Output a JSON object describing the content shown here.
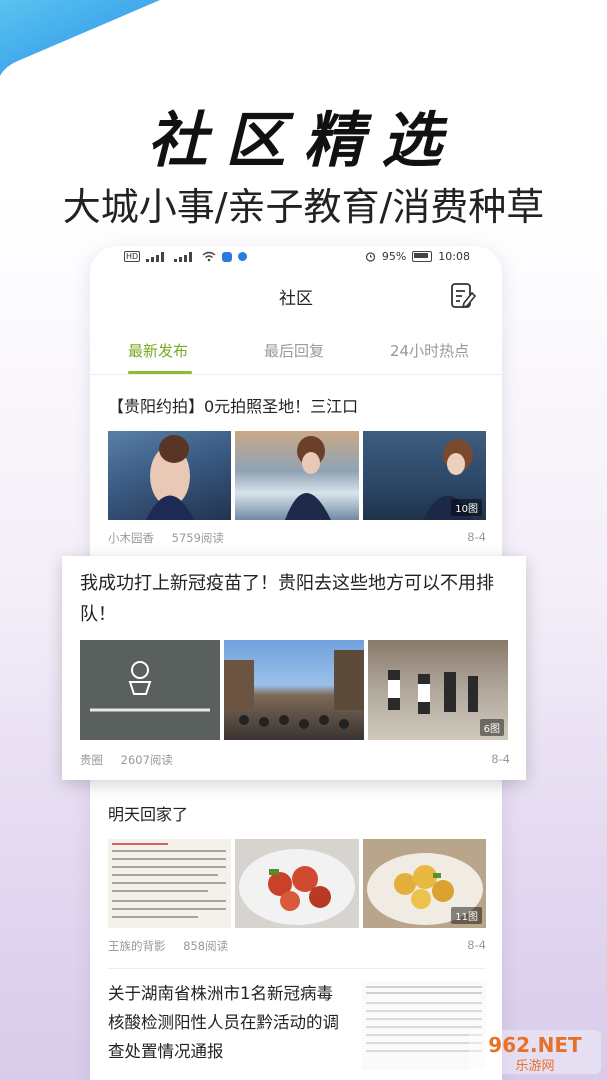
{
  "hero": {
    "title": "社区精选",
    "subtitle": "大城小事/亲子教育/消费种草"
  },
  "statusbar": {
    "battery": "95%",
    "time": "10:08",
    "icons": [
      "hd-icon",
      "signal-icon",
      "signal-icon",
      "wifi-icon",
      "shield-app-icon",
      "app-icon",
      "alarm-icon",
      "battery-icon"
    ]
  },
  "app": {
    "title": "社区",
    "tabs": [
      "最新发布",
      "最后回复",
      "24小时热点"
    ],
    "active_tab": 0,
    "accent": "#8bbd2e"
  },
  "posts": [
    {
      "title": "【贵阳约拍】0元拍照圣地！三江口",
      "author": "小木园香",
      "reads": "5759阅读",
      "date": "8-4",
      "count": "10图"
    },
    {
      "title": "我成功打上新冠疫苗了！贵阳去这些地方可以不用排队！",
      "author": "贵圈",
      "reads": "2607阅读",
      "date": "8-4",
      "count": "6图"
    },
    {
      "title": "明天回家了",
      "author": "王族的背影",
      "reads": "858阅读",
      "date": "8-4",
      "count": "11图"
    },
    {
      "title": "关于湖南省株洲市1名新冠病毒核酸检测阳性人员在黔活动的调查处置情况通报"
    }
  ],
  "watermark": {
    "brand": "962.NET",
    "sub": "乐游网"
  }
}
